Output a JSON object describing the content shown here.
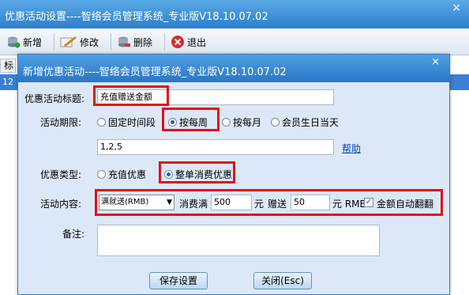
{
  "outer": {
    "title": "优惠活动设置----智络会员管理系统_专业版V18.10.07.02",
    "close": "×",
    "toolbar": {
      "add": "新增",
      "edit": "修改",
      "delete": "删除",
      "exit": "退出"
    },
    "grid_header": "标",
    "grid_row_value": "12"
  },
  "dialog": {
    "title": "新增优惠活动----智络会员管理系统_专业版V18.10.07.02",
    "close": "×",
    "form": {
      "title_label": "优惠活动标题:",
      "title_value": "充值赠送金额",
      "period_label": "活动期限:",
      "period_options": [
        "固定时间段",
        "按每周",
        "按每月",
        "会员生日当天"
      ],
      "period_selected": "按每周",
      "period_days_value": "1,2,5",
      "help_link": "帮助",
      "type_label": "优惠类型:",
      "type_options": [
        "充值优惠",
        "整单消费优惠"
      ],
      "type_selected": "整单消费优惠",
      "content_label": "活动内容:",
      "content_select": "满就送(RMB)",
      "spend_label": "消费满",
      "spend_value": "500",
      "yuan1": "元",
      "give_label": "赠送",
      "give_value": "50",
      "yuan_rmb": "元 RMB",
      "auto_flip_label": "金额自动翻翻",
      "auto_flip_checked": true,
      "remark_label": "备注:",
      "remark_value": ""
    },
    "buttons": {
      "save": "保存设置",
      "close": "关闭(Esc)"
    }
  },
  "colors": {
    "highlight": "#e0101a",
    "titlebar": "#2a76c6"
  }
}
